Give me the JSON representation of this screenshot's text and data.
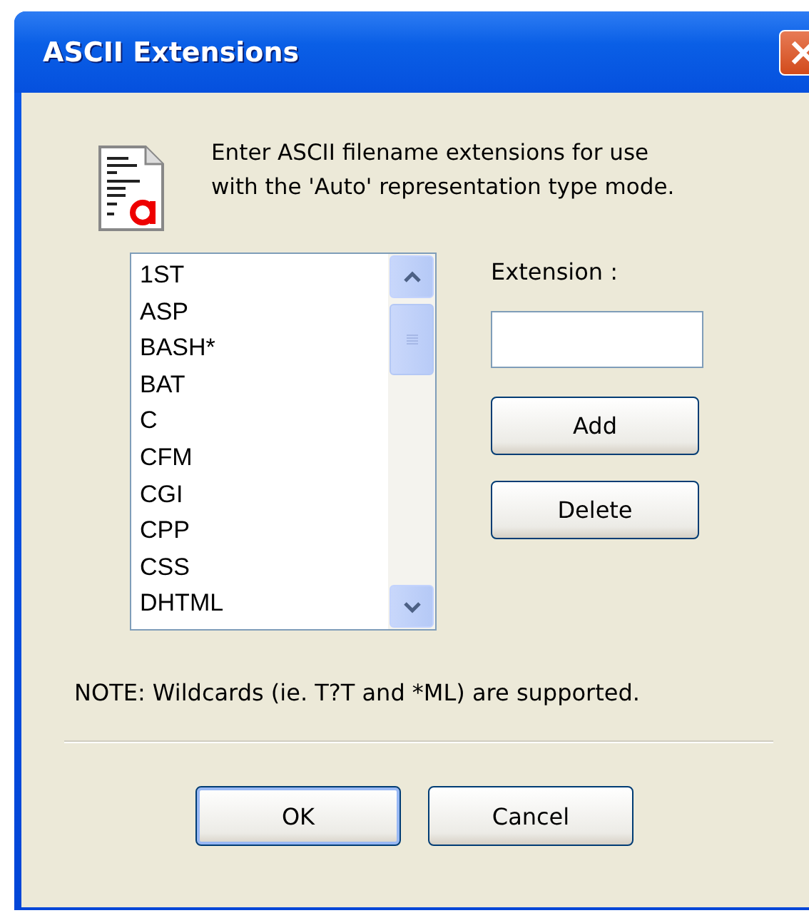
{
  "window": {
    "title": "ASCII Extensions"
  },
  "intro": "Enter ASCII filename extensions for use with the 'Auto' representation type mode.",
  "extensions": [
    "1ST",
    "ASP",
    "BASH*",
    "BAT",
    "C",
    "CFM",
    "CGI",
    "CPP",
    "CSS",
    "DHTML"
  ],
  "extension_field": {
    "label": "Extension :"
  },
  "side_buttons": [
    "Add",
    "Delete"
  ],
  "note": "NOTE: Wildcards (ie. T?T and *ML) are supported.",
  "buttons": [
    {
      "label": "OK",
      "default": true
    },
    {
      "label": "Cancel",
      "default": false
    }
  ]
}
